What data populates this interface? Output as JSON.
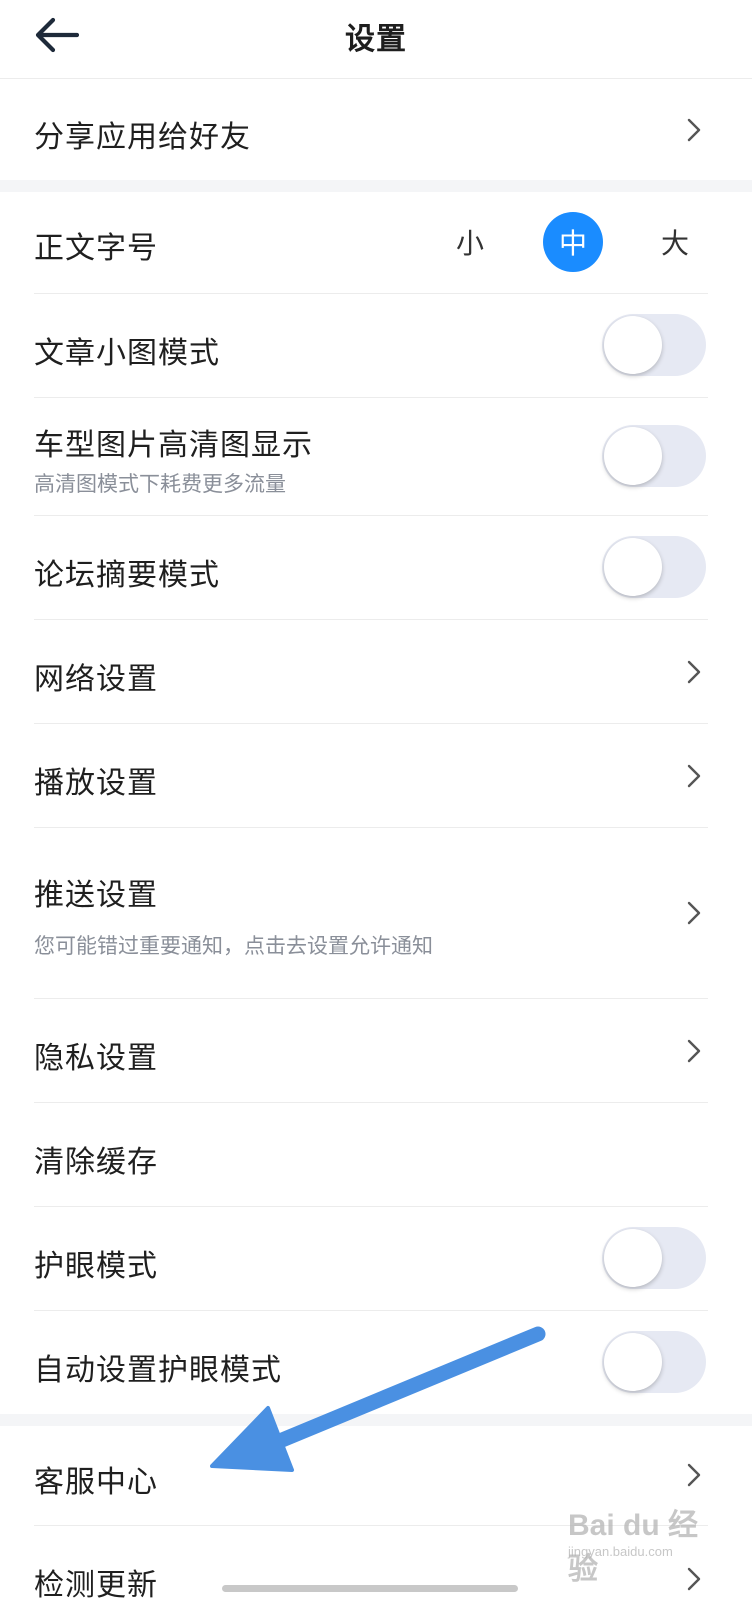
{
  "header": {
    "title": "设置"
  },
  "share": {
    "label": "分享应用给好友"
  },
  "font_size": {
    "label": "正文字号",
    "options": [
      "小",
      "中",
      "大"
    ],
    "selected": "中"
  },
  "settings": {
    "article_small_image": {
      "label": "文章小图模式",
      "enabled": false
    },
    "hd_car_images": {
      "label": "车型图片高清图显示",
      "subtitle": "高清图模式下耗费更多流量",
      "enabled": false
    },
    "forum_summary": {
      "label": "论坛摘要模式",
      "enabled": false
    },
    "network": {
      "label": "网络设置"
    },
    "playback": {
      "label": "播放设置"
    },
    "push": {
      "label": "推送设置",
      "subtitle": "您可能错过重要通知，点击去设置允许通知"
    },
    "privacy": {
      "label": "隐私设置"
    },
    "clear_cache": {
      "label": "清除缓存"
    },
    "eye_care": {
      "label": "护眼模式",
      "enabled": false
    },
    "auto_eye_care": {
      "label": "自动设置护眼模式",
      "enabled": false
    }
  },
  "support": {
    "customer_service": {
      "label": "客服中心"
    },
    "check_update": {
      "label": "检测更新"
    }
  },
  "watermark": {
    "main": "Bai du 经验",
    "sub": "jingyan.baidu.com"
  },
  "colors": {
    "accent": "#1a8cff",
    "arrow": "#4a90e2",
    "toggle_off": "#e6e9f3"
  },
  "icons": {
    "back": "arrow-left-icon",
    "chevron": "chevron-right-icon"
  }
}
